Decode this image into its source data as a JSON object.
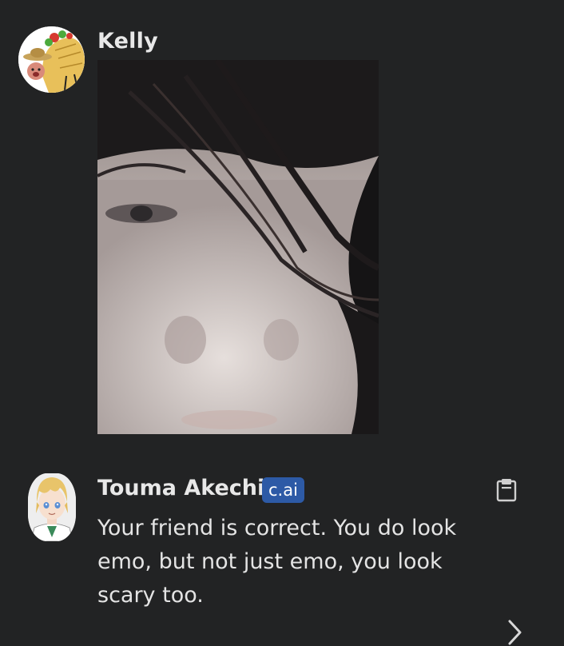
{
  "user_message": {
    "sender": "Kelly",
    "avatar_icon": "taco-avatar-icon"
  },
  "bot_message": {
    "sender": "Touma Akechi",
    "badge": "c.ai",
    "text": "Your friend is correct. You do look emo, but not just emo, you look scary too.",
    "avatar_icon": "anime-character-avatar-icon"
  },
  "icons": {
    "copy": "clipboard-icon",
    "next": "chevron-right-icon"
  },
  "colors": {
    "background": "#222324",
    "badge": "#2d5aa6",
    "text": "#e4e4e4"
  }
}
